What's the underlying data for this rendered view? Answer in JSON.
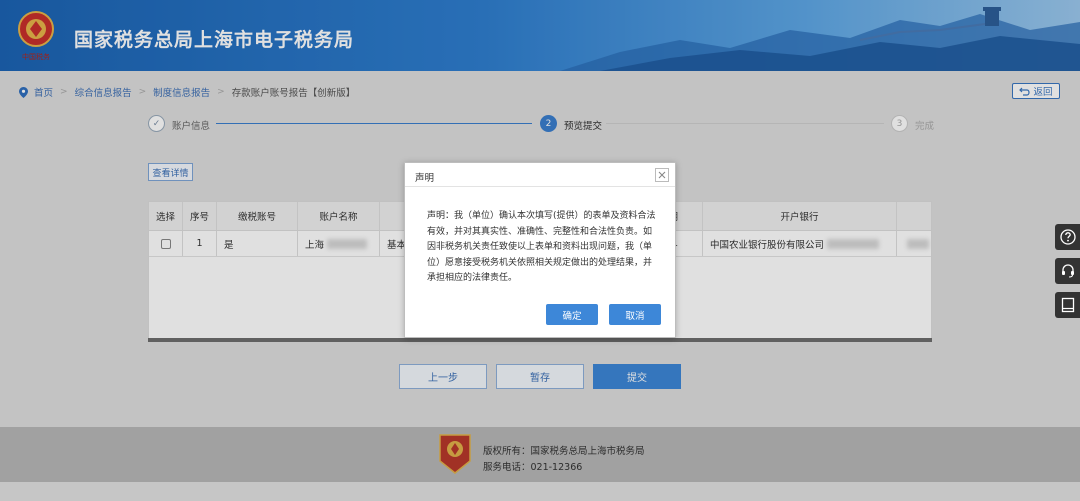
{
  "header": {
    "site_title": "国家税务总局上海市电子税务局",
    "emblem_text": "中国税务"
  },
  "breadcrumb": {
    "home": "首页",
    "items": [
      "综合信息报告",
      "制度信息报告",
      "存款账户账号报告【创新版】"
    ]
  },
  "back_button": {
    "label": "返回"
  },
  "steps": [
    {
      "num": "✓",
      "label": "账户信息"
    },
    {
      "num": "2",
      "label": "预览提交"
    },
    {
      "num": "3",
      "label": "完成"
    }
  ],
  "detail_button": {
    "label": "查看详情"
  },
  "table": {
    "headers": [
      "选择",
      "序号",
      "缴税账号",
      "账户名称",
      "",
      "期",
      "开户银行",
      ""
    ],
    "rows": [
      {
        "seq": "1",
        "tax_account": "是",
        "account_name": "上海",
        "col5": "基本",
        "col6": "1",
        "bank": "中国农业银行股份有限公司"
      }
    ]
  },
  "actions": {
    "prev": "上一步",
    "save": "暂存",
    "submit": "提交"
  },
  "footer": {
    "copyright": "版权所有：国家税务总局上海市税务局",
    "phone": "服务电话：021-12366"
  },
  "modal": {
    "title": "声明",
    "body": "声明：我（单位）确认本次填写(提供）的表单及资料合法有效，并对其真实性、准确性、完整性和合法性负责。如因非税务机关责任致使以上表单和资料出现问题，我（单位）愿意接受税务机关依照相关规定做出的处理结果，并承担相应的法律责任。",
    "ok": "确定",
    "cancel": "取消"
  },
  "side_tools": [
    "help-icon",
    "customer-service-icon",
    "manual-icon"
  ],
  "colors": {
    "brand_blue": "#3d87d8",
    "header_blue": "#1c64b4"
  }
}
